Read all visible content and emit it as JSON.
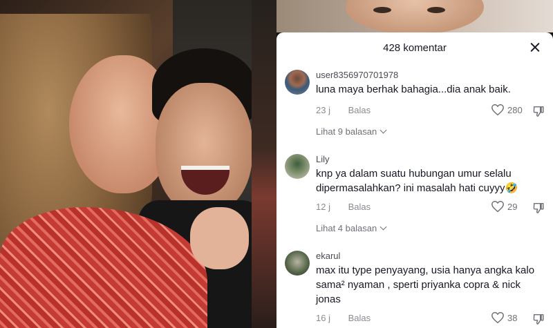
{
  "panel": {
    "title": "428 komentar",
    "close_icon": "close-icon"
  },
  "comments": [
    {
      "username": "user8356970701978",
      "text": "luna maya berhak bahagia...dia anak baik.",
      "time": "23 j",
      "reply_label": "Balas",
      "likes": "280",
      "view_replies": "Lihat 9 balasan"
    },
    {
      "username": "Lily",
      "text": "knp ya dalam suatu hubungan umur selalu dipermasalahkan? ini masalah hati cuyyy🤣",
      "time": "12 j",
      "reply_label": "Balas",
      "likes": "29",
      "view_replies": "Lihat 4 balasan"
    },
    {
      "username": "ekarul",
      "text": "max itu type penyayang, usia hanya angka kalo sama² nyaman , sperti priyanka copra & nick jonas",
      "time": "16 j",
      "reply_label": "Balas",
      "likes": "38"
    }
  ],
  "icons": {
    "like": "heart-outline-icon",
    "dislike": "thumbs-down-icon",
    "expand": "chevron-down-icon"
  },
  "colors": {
    "panel_bg": "#ffffff",
    "text_primary": "#161823",
    "text_secondary": "#8a8b91"
  }
}
